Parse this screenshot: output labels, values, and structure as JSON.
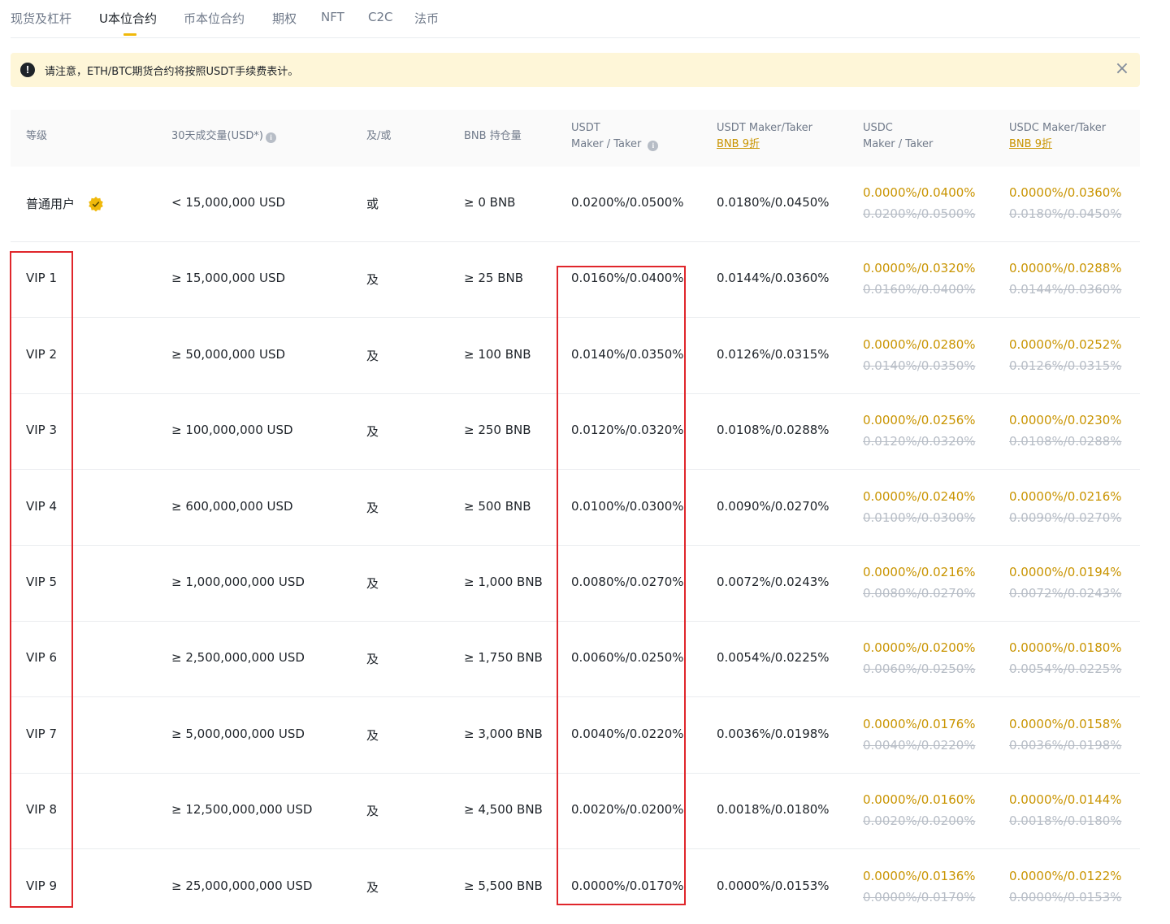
{
  "tabs": [
    {
      "label": "现货及杠杆",
      "active": false
    },
    {
      "label": "U本位合约",
      "active": true
    },
    {
      "label": "币本位合约",
      "active": false
    },
    {
      "label": "期权",
      "active": false
    },
    {
      "label": "NFT",
      "active": false
    },
    {
      "label": "C2C",
      "active": false
    },
    {
      "label": "法币",
      "active": false
    }
  ],
  "notice": {
    "icon": "exclamation-icon",
    "text": "请注意，ETH/BTC期货合约将按照USDT手续费表计。",
    "close_icon": "close-icon"
  },
  "columns": {
    "level": "等级",
    "volume": "30天成交量(USD*)",
    "andor": "及/或",
    "bnb": "BNB 持仓量",
    "usdt_line1": "USDT",
    "usdt_line2": "Maker / Taker",
    "usdt_bnb_line1": "USDT Maker/Taker",
    "usdt_bnb_link": "BNB 9折",
    "usdc_line1": "USDC",
    "usdc_line2": "Maker / Taker",
    "usdc_bnb_line1": "USDC Maker/Taker",
    "usdc_bnb_link": "BNB 9折"
  },
  "rows": [
    {
      "level": "普通用户",
      "verified": true,
      "volume": "< 15,000,000 USD",
      "andor": "或",
      "bnb": "≥ 0 BNB",
      "usdt": "0.0200%/0.0500%",
      "usdt_bnb": "0.0180%/0.0450%",
      "usdc_new": "0.0000%/0.0400%",
      "usdc_old": "0.0200%/0.0500%",
      "usdc_bnb_new": "0.0000%/0.0360%",
      "usdc_bnb_old": "0.0180%/0.0450%"
    },
    {
      "level": "VIP 1",
      "volume": "≥ 15,000,000 USD",
      "andor": "及",
      "bnb": "≥ 25 BNB",
      "usdt": "0.0160%/0.0400%",
      "usdt_bnb": "0.0144%/0.0360%",
      "usdc_new": "0.0000%/0.0320%",
      "usdc_old": "0.0160%/0.0400%",
      "usdc_bnb_new": "0.0000%/0.0288%",
      "usdc_bnb_old": "0.0144%/0.0360%"
    },
    {
      "level": "VIP 2",
      "volume": "≥ 50,000,000 USD",
      "andor": "及",
      "bnb": "≥ 100 BNB",
      "usdt": "0.0140%/0.0350%",
      "usdt_bnb": "0.0126%/0.0315%",
      "usdc_new": "0.0000%/0.0280%",
      "usdc_old": "0.0140%/0.0350%",
      "usdc_bnb_new": "0.0000%/0.0252%",
      "usdc_bnb_old": "0.0126%/0.0315%"
    },
    {
      "level": "VIP 3",
      "volume": "≥ 100,000,000 USD",
      "andor": "及",
      "bnb": "≥ 250 BNB",
      "usdt": "0.0120%/0.0320%",
      "usdt_bnb": "0.0108%/0.0288%",
      "usdc_new": "0.0000%/0.0256%",
      "usdc_old": "0.0120%/0.0320%",
      "usdc_bnb_new": "0.0000%/0.0230%",
      "usdc_bnb_old": "0.0108%/0.0288%"
    },
    {
      "level": "VIP 4",
      "volume": "≥ 600,000,000 USD",
      "andor": "及",
      "bnb": "≥ 500 BNB",
      "usdt": "0.0100%/0.0300%",
      "usdt_bnb": "0.0090%/0.0270%",
      "usdc_new": "0.0000%/0.0240%",
      "usdc_old": "0.0100%/0.0300%",
      "usdc_bnb_new": "0.0000%/0.0216%",
      "usdc_bnb_old": "0.0090%/0.0270%"
    },
    {
      "level": "VIP 5",
      "volume": "≥ 1,000,000,000 USD",
      "andor": "及",
      "bnb": "≥ 1,000 BNB",
      "usdt": "0.0080%/0.0270%",
      "usdt_bnb": "0.0072%/0.0243%",
      "usdc_new": "0.0000%/0.0216%",
      "usdc_old": "0.0080%/0.0270%",
      "usdc_bnb_new": "0.0000%/0.0194%",
      "usdc_bnb_old": "0.0072%/0.0243%"
    },
    {
      "level": "VIP 6",
      "volume": "≥ 2,500,000,000 USD",
      "andor": "及",
      "bnb": "≥ 1,750 BNB",
      "usdt": "0.0060%/0.0250%",
      "usdt_bnb": "0.0054%/0.0225%",
      "usdc_new": "0.0000%/0.0200%",
      "usdc_old": "0.0060%/0.0250%",
      "usdc_bnb_new": "0.0000%/0.0180%",
      "usdc_bnb_old": "0.0054%/0.0225%"
    },
    {
      "level": "VIP 7",
      "volume": "≥ 5,000,000,000 USD",
      "andor": "及",
      "bnb": "≥ 3,000 BNB",
      "usdt": "0.0040%/0.0220%",
      "usdt_bnb": "0.0036%/0.0198%",
      "usdc_new": "0.0000%/0.0176%",
      "usdc_old": "0.0040%/0.0220%",
      "usdc_bnb_new": "0.0000%/0.0158%",
      "usdc_bnb_old": "0.0036%/0.0198%"
    },
    {
      "level": "VIP 8",
      "volume": "≥ 12,500,000,000 USD",
      "andor": "及",
      "bnb": "≥ 4,500 BNB",
      "usdt": "0.0020%/0.0200%",
      "usdt_bnb": "0.0018%/0.0180%",
      "usdc_new": "0.0000%/0.0160%",
      "usdc_old": "0.0020%/0.0200%",
      "usdc_bnb_new": "0.0000%/0.0144%",
      "usdc_bnb_old": "0.0018%/0.0180%"
    },
    {
      "level": "VIP 9",
      "volume": "≥ 25,000,000,000 USD",
      "andor": "及",
      "bnb": "≥ 5,500 BNB",
      "usdt": "0.0000%/0.0170%",
      "usdt_bnb": "0.0000%/0.0153%",
      "usdc_new": "0.0000%/0.0136%",
      "usdc_old": "0.0000%/0.0170%",
      "usdc_bnb_new": "0.0000%/0.0122%",
      "usdc_bnb_old": "0.0000%/0.0153%"
    }
  ],
  "colors": {
    "accent": "#f0b90b",
    "discount_text": "#c99400",
    "strikethrough_text": "#b7bdc6",
    "highlight_box": "#e0262b",
    "notice_bg": "#fef6d8"
  }
}
